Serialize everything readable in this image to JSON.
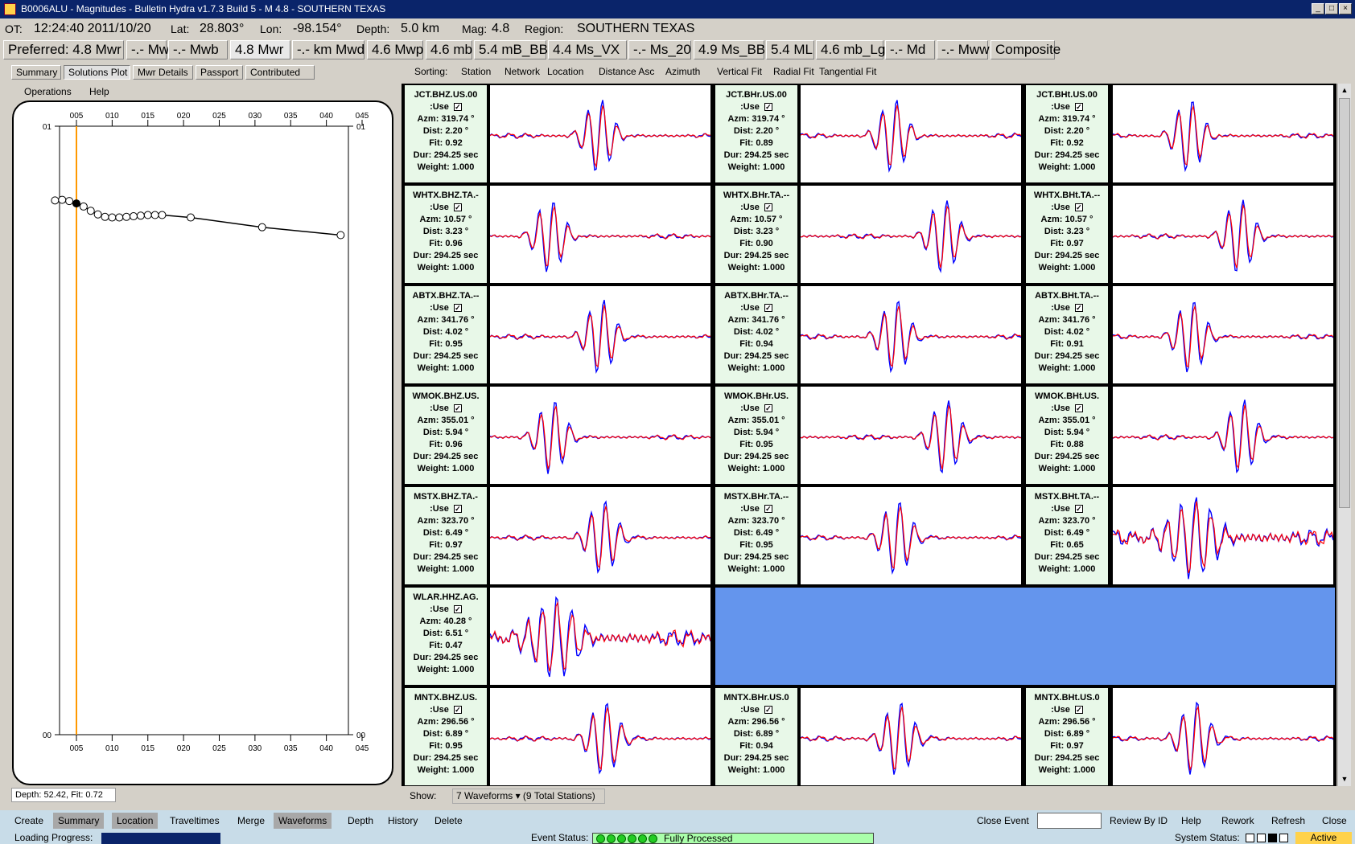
{
  "window": {
    "title": "B0006ALU - Magnitudes - Bulletin Hydra v1.7.3 Build 5 -  M 4.8  -  SOUTHERN TEXAS"
  },
  "info": {
    "ot_label": "OT:",
    "ot": "12:24:40 2011/10/20",
    "lat_label": "Lat:",
    "lat": "28.803°",
    "lon_label": "Lon:",
    "lon": "-98.154°",
    "depth_label": "Depth:",
    "depth": "5.0 km",
    "mag_label": "Mag:",
    "mag": "4.8",
    "region_label": "Region:",
    "region": "SOUTHERN TEXAS"
  },
  "mag_tabs": [
    "Preferred: 4.8 Mwr",
    "-.- Mwc",
    "-.- Mwb",
    "4.8 Mwr",
    "-.- km Mwd",
    "4.6 Mwp",
    "4.6 mb",
    "5.4 mB_BB",
    "4.4 Ms_VX",
    "-.- Ms_20",
    "4.9 Ms_BB",
    "5.4 ML",
    "4.6 mb_Lg",
    "-.- Md",
    "-.- Mww",
    "Composite"
  ],
  "sub_tabs": [
    "Summary",
    "Solutions Plot",
    "Mwr Details",
    "Passport",
    "Contributed"
  ],
  "menu": [
    "Operations",
    "Help"
  ],
  "plot": {
    "x_ticks": [
      "005",
      "010",
      "015",
      "020",
      "025",
      "030",
      "035",
      "040",
      "045"
    ],
    "y_top": "01",
    "y_bottom": "00"
  },
  "chart_data": {
    "type": "scatter",
    "x_ticks": [
      "005",
      "010",
      "015",
      "020",
      "025",
      "030",
      "035",
      "040",
      "045"
    ],
    "y_ticks": [
      "00",
      "01"
    ],
    "x": [
      1,
      2,
      3,
      4,
      5,
      6,
      7,
      8,
      9,
      10,
      11,
      12,
      13,
      14,
      15,
      16,
      20,
      30,
      41
    ],
    "y": [
      0.878,
      0.879,
      0.877,
      0.873,
      0.868,
      0.861,
      0.855,
      0.851,
      0.85,
      0.85,
      0.851,
      0.852,
      0.853,
      0.854,
      0.854,
      0.854,
      0.85,
      0.834,
      0.821
    ],
    "selected_x": 4,
    "reference_line_x": 4
  },
  "depthfit": "Depth: 52.42, Fit: 0.72",
  "sorting": {
    "label": "Sorting:",
    "items": [
      "Station",
      "Network",
      "Location",
      "Distance Asc",
      "Azimuth",
      "Vertical Fit",
      "Radial Fit",
      "Tangential Fit"
    ]
  },
  "stations": [
    [
      {
        "n": "JCT.BHZ.US.00",
        "azm": "Azm: 319.74 °",
        "dist": "Dist: 2.20 °",
        "fit": "Fit: 0.92"
      },
      {
        "n": "JCT.BHr.US.00",
        "azm": "Azm: 319.74 °",
        "dist": "Dist: 2.20 °",
        "fit": "Fit: 0.89"
      },
      {
        "n": "JCT.BHt.US.00",
        "azm": "Azm: 319.74 °",
        "dist": "Dist: 2.20 °",
        "fit": "Fit: 0.92"
      }
    ],
    [
      {
        "n": "WHTX.BHZ.TA.-",
        "azm": "Azm: 10.57 °",
        "dist": "Dist: 3.23 °",
        "fit": "Fit: 0.96"
      },
      {
        "n": "WHTX.BHr.TA.--",
        "azm": "Azm: 10.57 °",
        "dist": "Dist: 3.23 °",
        "fit": "Fit: 0.90"
      },
      {
        "n": "WHTX.BHt.TA.--",
        "azm": "Azm: 10.57 °",
        "dist": "Dist: 3.23 °",
        "fit": "Fit: 0.97"
      }
    ],
    [
      {
        "n": "ABTX.BHZ.TA.--",
        "azm": "Azm: 341.76 °",
        "dist": "Dist: 4.02 °",
        "fit": "Fit: 0.95"
      },
      {
        "n": "ABTX.BHr.TA.--",
        "azm": "Azm: 341.76 °",
        "dist": "Dist: 4.02 °",
        "fit": "Fit: 0.94"
      },
      {
        "n": "ABTX.BHt.TA.--",
        "azm": "Azm: 341.76 °",
        "dist": "Dist: 4.02 °",
        "fit": "Fit: 0.91"
      }
    ],
    [
      {
        "n": "WMOK.BHZ.US.",
        "azm": "Azm: 355.01 °",
        "dist": "Dist: 5.94 °",
        "fit": "Fit: 0.96"
      },
      {
        "n": "WMOK.BHr.US.",
        "azm": "Azm: 355.01 °",
        "dist": "Dist: 5.94 °",
        "fit": "Fit: 0.95"
      },
      {
        "n": "WMOK.BHt.US.",
        "azm": "Azm: 355.01 °",
        "dist": "Dist: 5.94 °",
        "fit": "Fit: 0.88"
      }
    ],
    [
      {
        "n": "MSTX.BHZ.TA.-",
        "azm": "Azm: 323.70 °",
        "dist": "Dist: 6.49 °",
        "fit": "Fit: 0.97"
      },
      {
        "n": "MSTX.BHr.TA.--",
        "azm": "Azm: 323.70 °",
        "dist": "Dist: 6.49 °",
        "fit": "Fit: 0.95"
      },
      {
        "n": "MSTX.BHt.TA.--",
        "azm": "Azm: 323.70 °",
        "dist": "Dist: 6.49 °",
        "fit": "Fit: 0.65"
      }
    ],
    [
      {
        "n": "WLAR.HHZ.AG.",
        "azm": "Azm: 40.28 °",
        "dist": "Dist: 6.51 °",
        "fit": "Fit: 0.47"
      }
    ],
    [
      {
        "n": "MNTX.BHZ.US.",
        "azm": "Azm: 296.56 °",
        "dist": "Dist: 6.89 °",
        "fit": "Fit: 0.95"
      },
      {
        "n": "MNTX.BHr.US.0",
        "azm": "Azm: 296.56 °",
        "dist": "Dist: 6.89 °",
        "fit": "Fit: 0.94"
      },
      {
        "n": "MNTX.BHt.US.0",
        "azm": "Azm: 296.56 °",
        "dist": "Dist: 6.89 °",
        "fit": "Fit: 0.97"
      }
    ]
  ],
  "common": {
    "use": ":Use",
    "dur": "Dur: 294.25 sec",
    "weight": "Weight: 1.000"
  },
  "show": {
    "label": "Show:",
    "value": "7 Waveforms  ▾  (9 Total Stations)"
  },
  "bottom_left": [
    "Create",
    "Summary",
    "Location",
    "Traveltimes",
    "Merge",
    "Waveforms",
    "Depth",
    "History",
    "Delete"
  ],
  "bottom_right": {
    "close_event": "Close Event",
    "review": "Review By ID",
    "help": "Help",
    "rework": "Rework",
    "refresh": "Refresh",
    "close": "Close"
  },
  "status": {
    "loading": "Loading Progress:",
    "event": "Event Status:",
    "processed": "Fully Processed",
    "system": "System Status:",
    "active": "Active"
  },
  "colors": {
    "observed": "#0000ff",
    "synthetic": "#ff0000",
    "title_bg": "#0a246a",
    "cell_bg": "#e8f8e8",
    "blank": "#6495ed"
  }
}
